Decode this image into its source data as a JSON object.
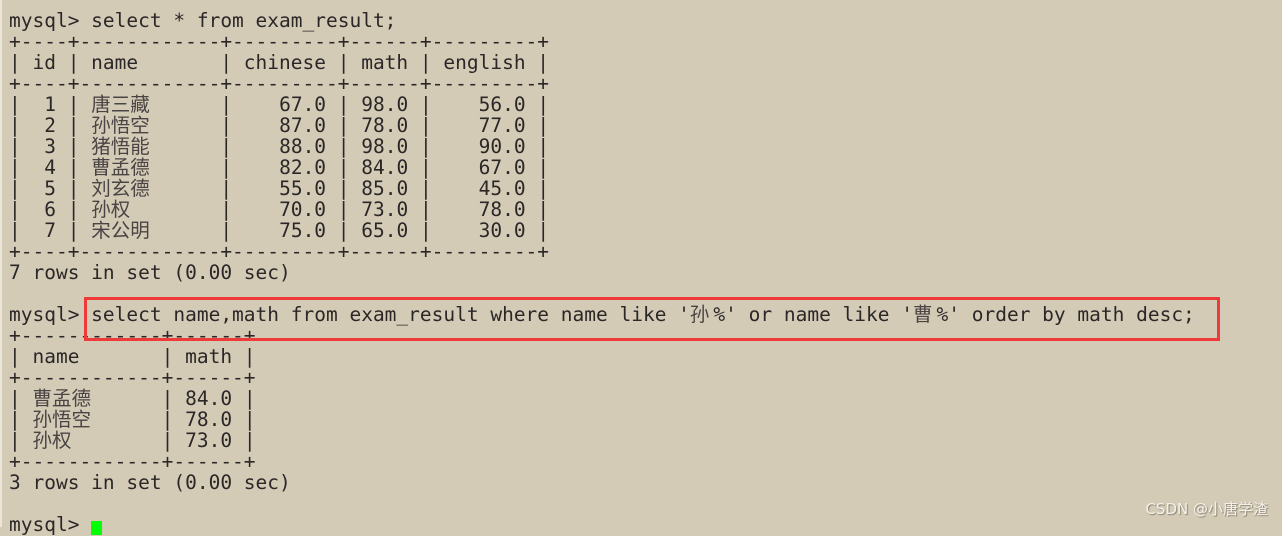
{
  "terminal": {
    "prompt": "mysql> ",
    "query1": "select * from exam_result;",
    "table1": {
      "columns": [
        "id",
        "name",
        "chinese",
        "math",
        "english"
      ],
      "rows": [
        [
          "1",
          "唐三藏",
          "67.0",
          "98.0",
          "56.0"
        ],
        [
          "2",
          "孙悟空",
          "87.0",
          "78.0",
          "77.0"
        ],
        [
          "3",
          "猪悟能",
          "88.0",
          "98.0",
          "90.0"
        ],
        [
          "4",
          "曹孟德",
          "82.0",
          "84.0",
          "67.0"
        ],
        [
          "5",
          "刘玄德",
          "55.0",
          "85.0",
          "45.0"
        ],
        [
          "6",
          "孙权",
          "70.0",
          "73.0",
          "78.0"
        ],
        [
          "7",
          "宋公明",
          "75.0",
          "65.0",
          "30.0"
        ]
      ],
      "summary": "7 rows in set (0.00 sec)"
    },
    "query2": "select name,math from exam_result where name like '孙%' or name like '曹%' order by math desc;",
    "table2": {
      "columns": [
        "name",
        "math"
      ],
      "rows": [
        [
          "曹孟德",
          "84.0"
        ],
        [
          "孙悟空",
          "78.0"
        ],
        [
          "孙权",
          "73.0"
        ]
      ],
      "summary": "3 rows in set (0.00 sec)"
    },
    "final_prompt": "mysql> "
  },
  "highlight_color": "#ef3a3a",
  "cursor_color": "#00ff00",
  "watermark": "CSDN @小唐学渣"
}
